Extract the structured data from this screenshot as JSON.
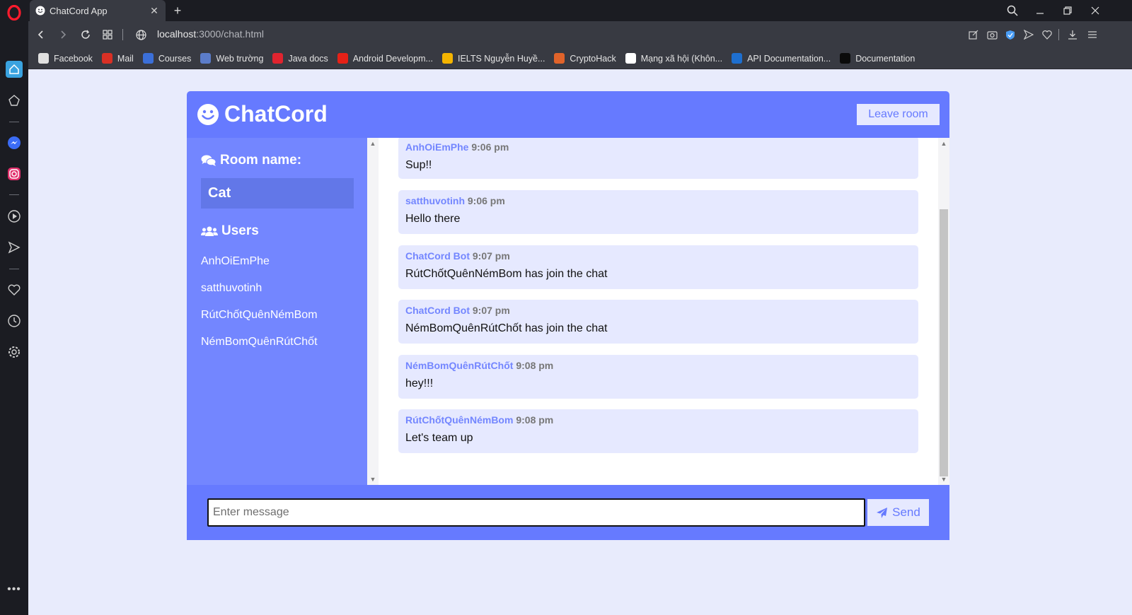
{
  "browser": {
    "tab_title": "ChatCord App",
    "tab_close": "✕",
    "new_tab": "+",
    "url_host": "localhost",
    "url_path": ":3000/chat.html",
    "bookmarks": [
      {
        "label": "Facebook",
        "icon": "document-icon",
        "color": "#e0e0e0"
      },
      {
        "label": "Mail",
        "icon": "gmail-icon",
        "color": "#d93025"
      },
      {
        "label": "Courses",
        "icon": "courses-icon",
        "color": "#3b6fd8"
      },
      {
        "label": "Web trường",
        "icon": "globe-icon",
        "color": "#5b7cc9"
      },
      {
        "label": "Java docs",
        "icon": "opera-icon",
        "color": "#e0242f"
      },
      {
        "label": "Android Developm...",
        "icon": "youtube-icon",
        "color": "#e62117"
      },
      {
        "label": "IELTS Nguyễn Huyề...",
        "icon": "drive-icon",
        "color": "#f4b400"
      },
      {
        "label": "CryptoHack",
        "icon": "cryptohack-icon",
        "color": "#e0632a"
      },
      {
        "label": "Mạng xã hội (Khôn...",
        "icon": "notion-icon",
        "color": "#ffffff"
      },
      {
        "label": "API Documentation...",
        "icon": "api-icon",
        "color": "#1e6fcf"
      },
      {
        "label": "Documentation",
        "icon": "docs-icon",
        "color": "#0b0b0b"
      }
    ]
  },
  "app": {
    "logo": "ChatCord",
    "leave_button": "Leave room",
    "room_heading": "Room name:",
    "room_name": "Cat",
    "users_heading": "Users",
    "users": [
      "AnhOiEmPhe",
      "satthuvotinh",
      "RútChốtQuênNémBom",
      "NémBomQuênRútChốt"
    ],
    "messages": [
      {
        "user": "AnhOiEmPhe",
        "time": "9:06 pm",
        "text": "Sup!!"
      },
      {
        "user": "satthuvotinh",
        "time": "9:06 pm",
        "text": "Hello there"
      },
      {
        "user": "ChatCord Bot",
        "time": "9:07 pm",
        "text": "RútChốtQuênNémBom has join the chat"
      },
      {
        "user": "ChatCord Bot",
        "time": "9:07 pm",
        "text": "NémBomQuênRútChốt has join the chat"
      },
      {
        "user": "NémBomQuênRútChốt",
        "time": "9:08 pm",
        "text": "hey!!!"
      },
      {
        "user": "RútChốtQuênNémBom",
        "time": "9:08 pm",
        "text": "Let's team up"
      }
    ],
    "input_placeholder": "Enter message",
    "send_button": "Send"
  },
  "colors": {
    "primary": "#667aff",
    "sidebar": "#7386ff",
    "light": "#e6e9ff",
    "page_bg": "#e8ebfc"
  }
}
